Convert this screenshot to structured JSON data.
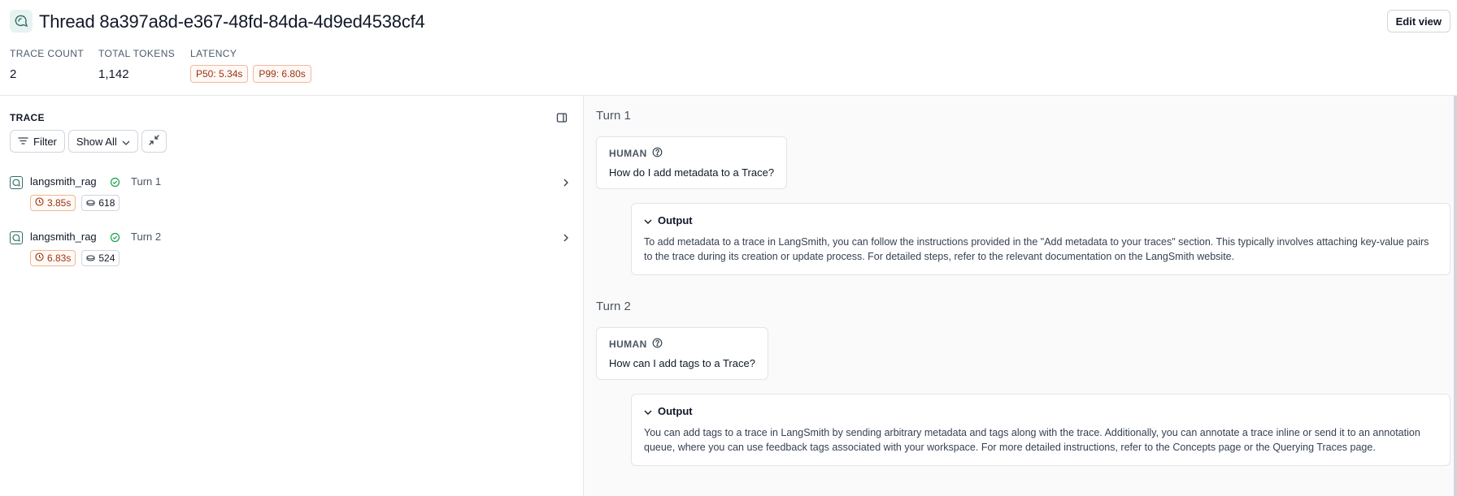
{
  "header": {
    "title": "Thread 8a397a8d-e367-48fd-84da-4d9ed4538cf4",
    "edit_view_label": "Edit view",
    "stats": {
      "trace_count_label": "TRACE COUNT",
      "trace_count": "2",
      "total_tokens_label": "TOTAL TOKENS",
      "total_tokens": "1,142",
      "latency_label": "LATENCY",
      "p50": "P50: 5.34s",
      "p99": "P99: 6.80s"
    }
  },
  "trace_panel": {
    "heading": "TRACE",
    "filter_label": "Filter",
    "show_all_label": "Show All",
    "rows": [
      {
        "name": "langsmith_rag",
        "turn": "Turn 1",
        "latency": "3.85s",
        "tokens": "618",
        "status": "success"
      },
      {
        "name": "langsmith_rag",
        "turn": "Turn 2",
        "latency": "6.83s",
        "tokens": "524",
        "status": "success"
      }
    ]
  },
  "conversation": {
    "turns": [
      {
        "heading": "Turn 1",
        "human_label": "HUMAN",
        "human_text": "How do I add metadata to a Trace?",
        "output_label": "Output",
        "output_text": "To add metadata to a trace in LangSmith, you can follow the instructions provided in the \"Add metadata to your traces\" section. This typically involves attaching key-value pairs to the trace during its creation or update process. For detailed steps, refer to the relevant documentation on the LangSmith website."
      },
      {
        "heading": "Turn 2",
        "human_label": "HUMAN",
        "human_text": "How can I add tags to a Trace?",
        "output_label": "Output",
        "output_text": "You can add tags to a trace in LangSmith by sending arbitrary metadata and tags along with the trace. Additionally, you can annotate a trace inline or send it to an annotation queue, where you can use feedback tags associated with your workspace. For more detailed instructions, refer to the Concepts page or the Querying Traces page."
      }
    ]
  },
  "colors": {
    "accent": "#2f6f65",
    "latency_badge": "#9a3412",
    "success": "#16a34a"
  },
  "icons": {
    "thread": "thread-bubble-icon",
    "filter": "filter-lines-icon",
    "collapse": "collapse-arrows-icon",
    "panel": "panel-toggle-icon",
    "status": "check-circle-icon",
    "clock": "clock-icon",
    "tokens": "tokens-icon",
    "help": "question-circle-icon"
  }
}
